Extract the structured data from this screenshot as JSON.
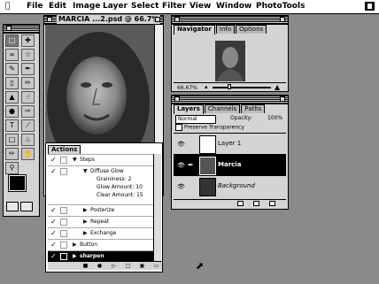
{
  "menubar": {
    "apple": "",
    "items": [
      "File",
      "Edit",
      "Image",
      "Layer",
      "Select",
      "Filter",
      "View",
      "Window",
      "PhotoTools"
    ]
  },
  "document": {
    "title": "MARCIA ...2.psd @ 66.7%"
  },
  "navigator": {
    "tabs": [
      "Navigator",
      "Info",
      "Options"
    ],
    "zoom": "66.67%"
  },
  "layers": {
    "tabs": [
      "Layers",
      "Channels",
      "Paths"
    ],
    "blend_mode": "Normal",
    "opacity_label": "Opacity:",
    "opacity_value": "100%",
    "preserve_label": "Preserve Transparency",
    "items": [
      {
        "name": "Layer 1",
        "selected": false
      },
      {
        "name": "Marcia",
        "selected": true
      },
      {
        "name": "Background",
        "selected": false
      }
    ]
  },
  "actions": {
    "tab": "Actions",
    "rows": [
      {
        "label": "Steps",
        "selected": false
      },
      {
        "label": "Diffuse Glow",
        "selected": false
      },
      {
        "label": "Posterize",
        "selected": false
      },
      {
        "label": "Repeat",
        "selected": false
      },
      {
        "label": "Exchange",
        "selected": false
      },
      {
        "label": "Button",
        "selected": false
      },
      {
        "label": "sharpen",
        "selected": true
      }
    ],
    "params": [
      "Graininess: 2",
      "Glow Amount: 10",
      "Clear Amount: 15"
    ]
  },
  "icons": [
    "apple-icon",
    "eye-icon",
    "brush-icon",
    "checkmark-icon",
    "play-icon",
    "stop-icon",
    "record-icon",
    "trash-icon",
    "new-layer-icon",
    "arrow-cursor-icon"
  ]
}
